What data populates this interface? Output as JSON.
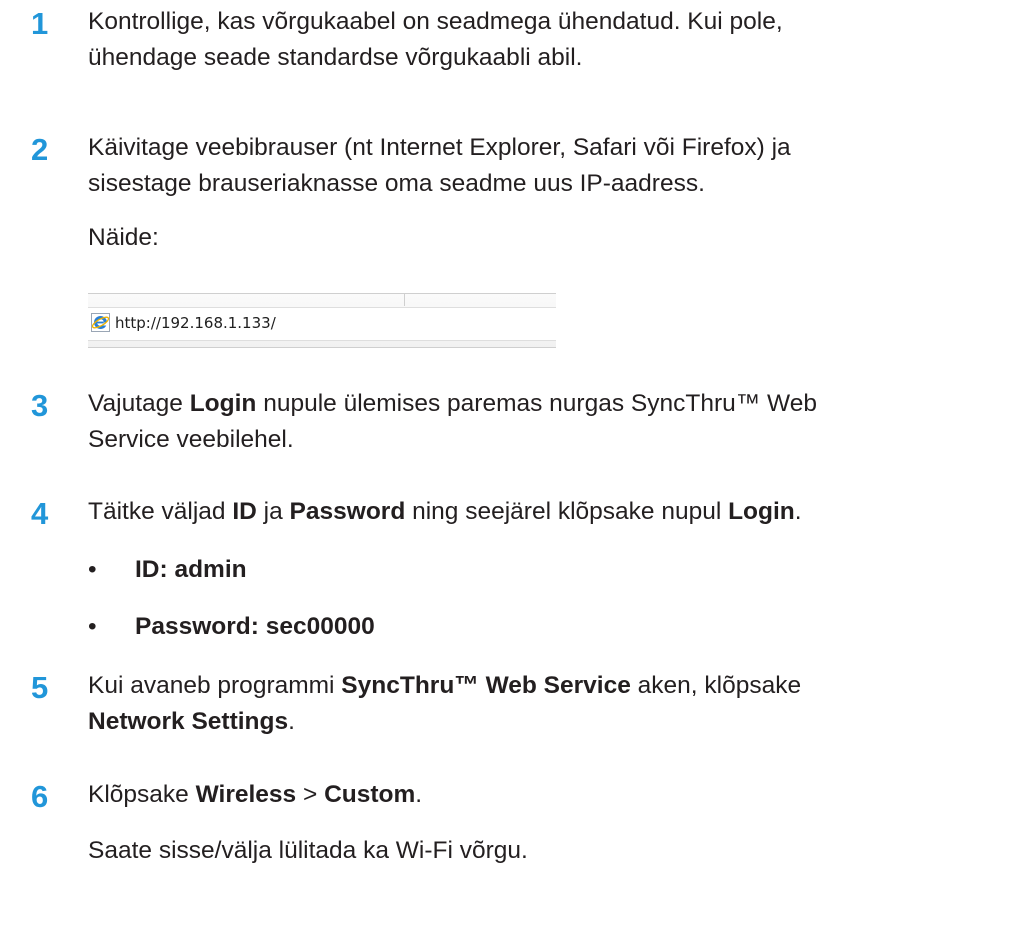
{
  "steps": [
    {
      "number": "1",
      "lines": [
        "Kontrollige, kas võrgukaabel on seadmega ühendatud. Kui pole,",
        "ühendage seade standardse võrgukaabli abil."
      ]
    },
    {
      "number": "2",
      "lines": [
        "Käivitage veebibrauser (nt Internet Explorer, Safari või Firefox) ja",
        "sisestage brauseriaknasse oma seadme uus IP-aadress."
      ],
      "example_label": "Näide:",
      "example_url": "http://192.168.1.133/",
      "example_icon": "internet-explorer-icon"
    },
    {
      "number": "3",
      "pre": "Vajutage ",
      "bold": "Login",
      "post": " nupule ülemises paremas nurgas SyncThru™ Web",
      "line2": "Service veebilehel."
    },
    {
      "number": "4",
      "pre": "Täitke väljad ",
      "bold1": "ID",
      "mid1": " ja ",
      "bold2": "Password",
      "mid2": " ning seejärel klõpsake nupul ",
      "bold3": "Login",
      "post": ".",
      "bullets": [
        "ID: admin",
        "Password: sec00000"
      ],
      "bullet_char": "•"
    },
    {
      "number": "5",
      "pre": "Kui avaneb programmi ",
      "bold1": "SyncThru™ Web Service",
      "post": " aken, klõpsake",
      "bold2": "Network Settings",
      "post2": "."
    },
    {
      "number": "6",
      "pre": "Klõpsake ",
      "bold1": "Wireless",
      "mid": " > ",
      "bold2": "Custom",
      "post": ".",
      "note": "Saate sisse/välja lülitada ka Wi-Fi võrgu."
    }
  ],
  "colors": {
    "step_number": "#2196d9",
    "text": "#231f20"
  }
}
